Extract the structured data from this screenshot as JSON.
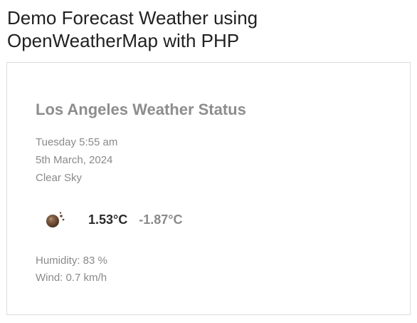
{
  "page": {
    "title_line1": "Demo Forecast Weather using",
    "title_line2": "OpenWeatherMap with PHP"
  },
  "weather": {
    "heading": "Los Angeles Weather Status",
    "day_time": "Tuesday 5:55 am",
    "date": "5th March, 2024",
    "condition": "Clear Sky",
    "icon": "clear-sky-night-icon",
    "temp_max": "1.53°C",
    "temp_min": "-1.87°C",
    "humidity": "Humidity: 83 %",
    "wind": "Wind: 0.7 km/h"
  },
  "colors": {
    "title_text": "#212121",
    "heading_text": "#8d8d8d",
    "muted_text": "#8a8a8a",
    "temp_max_text": "#2b2b2b",
    "card_border": "#dddddd",
    "icon_brown": "#6b4a32"
  }
}
